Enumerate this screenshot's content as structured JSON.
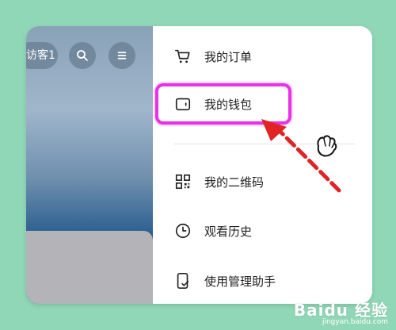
{
  "header": {
    "guest_chip": "访客1"
  },
  "menu": {
    "items": [
      {
        "label": "我的订单",
        "icon": "cart-icon"
      },
      {
        "label": "我的钱包",
        "icon": "wallet-icon"
      },
      {
        "label": "我的二维码",
        "icon": "qr-code-icon"
      },
      {
        "label": "观看历史",
        "icon": "clock-icon"
      },
      {
        "label": "使用管理助手",
        "icon": "phone-check-icon"
      }
    ]
  },
  "annotation": {
    "highlight_color": "#e633e6",
    "arrow_color": "#e02424"
  },
  "watermark": {
    "brand": "Baidu 经验",
    "url": "jingyan.baidu.com"
  },
  "colors": {
    "background": "#8fd7b6",
    "panel": "#ffffff"
  }
}
